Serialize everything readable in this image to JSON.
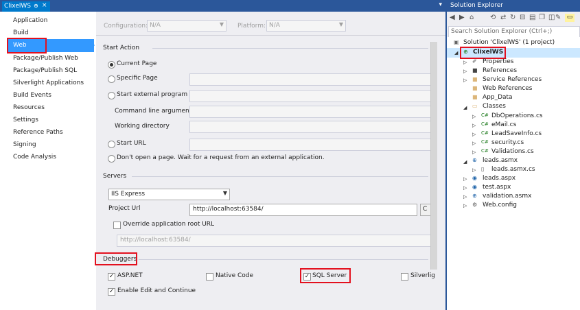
{
  "doc_tab": {
    "title": "ClixelWS",
    "pin": "⊕",
    "close": "×"
  },
  "nav": {
    "items": [
      "Application",
      "Build",
      "Web",
      "Package/Publish Web",
      "Package/Publish SQL",
      "Silverlight Applications",
      "Build Events",
      "Resources",
      "Settings",
      "Reference Paths",
      "Signing",
      "Code Analysis"
    ],
    "selected": "Web"
  },
  "config_bar": {
    "configuration_label": "Configuration:",
    "configuration_value": "N/A",
    "platform_label": "Platform:",
    "platform_value": "N/A"
  },
  "start_action": {
    "heading": "Start Action",
    "current_page": "Current Page",
    "specific_page": "Specific Page",
    "external_program": "Start external program",
    "cmd_args": "Command line arguments",
    "working_dir": "Working directory",
    "start_url": "Start URL",
    "dont_open": "Don't open a page.  Wait for a request from an external application."
  },
  "servers": {
    "heading": "Servers",
    "server": "IIS Express",
    "project_url_label": "Project Url",
    "project_url": "http://localhost:63584/",
    "create_button": "C",
    "override_label": "Override application root URL",
    "override_url": "http://localhost:63584/"
  },
  "debuggers": {
    "heading": "Debuggers",
    "aspnet": "ASP.NET",
    "native": "Native Code",
    "sql": "SQL Server",
    "silverlight": "Silverlig",
    "edit_continue": "Enable Edit and Continue"
  },
  "solution_explorer": {
    "title": "Solution Explorer",
    "search_placeholder": "Search Solution Explorer (Ctrl+;)",
    "solution": "Solution 'ClixelWS' (1 project)",
    "project": "ClixelWS",
    "nodes": [
      "Properties",
      "References",
      "Service References",
      "Web References",
      "App_Data",
      "Classes",
      "DbOperations.cs",
      "eMail.cs",
      "LeadSaveInfo.cs",
      "security.cs",
      "Validations.cs",
      "leads.asmx",
      "leads.asmx.cs",
      "leads.aspx",
      "test.aspx",
      "validation.asmx",
      "Web.config"
    ]
  },
  "colors": {
    "accent": "#3399ff",
    "highlight": "#e3101e",
    "title_bar": "#2b579a"
  }
}
